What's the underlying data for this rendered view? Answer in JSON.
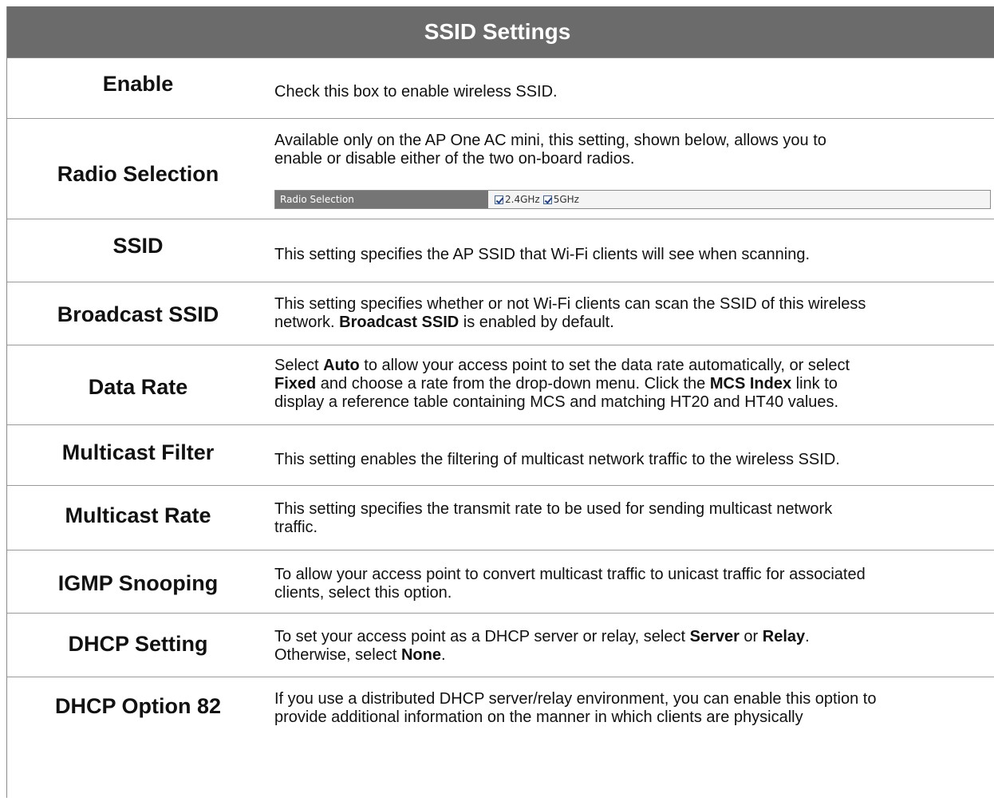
{
  "title": "SSID Settings",
  "rows": [
    {
      "label": "Enable",
      "text": "Check this box to enable wireless SSID."
    },
    {
      "label": "Radio Selection",
      "text_line1": "Available only on the AP One AC mini, this setting, shown below, allows you to",
      "text_line2": "enable or disable either of the two on-board radios.",
      "shot": {
        "label": "Radio Selection",
        "opt1": "2.4GHz",
        "opt2": "5GHz"
      }
    },
    {
      "label": "SSID",
      "text": "This setting specifies the AP SSID that Wi-Fi clients will see when scanning."
    },
    {
      "label": "Broadcast SSID",
      "text_line1": "This setting specifies whether or not Wi-Fi clients can scan the SSID of this wireless",
      "text_pre": "network. ",
      "text_bold": "Broadcast SSID",
      "text_post": " is enabled by default."
    },
    {
      "label": "Data Rate",
      "p1": "Select ",
      "b1": "Auto",
      "p2": " to allow your access point to set the data rate automatically, or select",
      "b2": "Fixed",
      "p3": " and choose a rate from the drop-down menu. Click the ",
      "b3": "MCS Index",
      "p4": " link to",
      "p5": "display a reference table containing MCS and matching HT20 and HT40 values."
    },
    {
      "label": "Multicast Filter",
      "text": "This setting enables the filtering of multicast network traffic to the wireless SSID."
    },
    {
      "label": "Multicast Rate",
      "text_line1": "This setting specifies the transmit rate to be used for sending multicast network",
      "text_line2": "traffic."
    },
    {
      "label": "IGMP Snooping",
      "text_line1": "To allow your access point to convert multicast traffic to unicast traffic for associated",
      "text_line2": "clients, select this option."
    },
    {
      "label": "DHCP Setting",
      "p1": "To set your access point as a DHCP server or relay, select ",
      "b1": "Server",
      "p2": " or ",
      "b2": "Relay",
      "p3": ".",
      "p4": "Otherwise, select ",
      "b3": "None",
      "p5": "."
    },
    {
      "label": "DHCP Option 82",
      "text_line1": "If you use a distributed DHCP server/relay environment, you can enable this option to",
      "text_line2": "provide additional information on the manner in which clients are physically"
    }
  ]
}
